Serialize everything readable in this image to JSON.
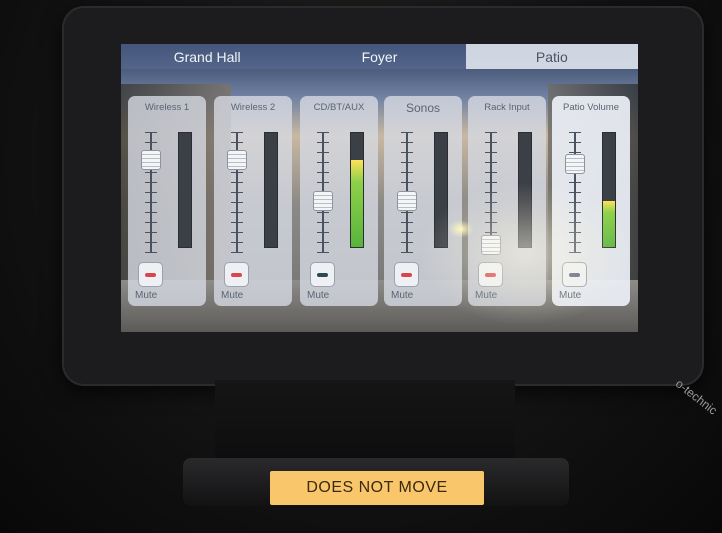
{
  "tabs": [
    {
      "label": "Grand Hall",
      "active": false
    },
    {
      "label": "Foyer",
      "active": false
    },
    {
      "label": "Patio",
      "active": true
    }
  ],
  "channels": [
    {
      "name": "Wireless 1",
      "fader_level": 0.82,
      "meter_level": 0.0,
      "mute_led": "#d9464e",
      "mute_label": "Mute"
    },
    {
      "name": "Wireless 2",
      "fader_level": 0.82,
      "meter_level": 0.0,
      "mute_led": "#d9464e",
      "mute_label": "Mute"
    },
    {
      "name": "CD/BT/AUX",
      "fader_level": 0.45,
      "meter_level": 0.76,
      "mute_led": "#2d4a52",
      "mute_label": "Mute"
    },
    {
      "name": "Sonos",
      "fader_level": 0.45,
      "meter_level": 0.0,
      "mute_led": "#d9464e",
      "mute_label": "Mute"
    },
    {
      "name": "Rack Input",
      "fader_level": 0.05,
      "meter_level": 0.0,
      "mute_led": "#d9464e",
      "mute_label": "Mute"
    },
    {
      "name": "Patio Volume",
      "fader_level": 0.78,
      "meter_level": 0.4,
      "mute_led": "#5a6680",
      "mute_label": "Mute",
      "active": true
    }
  ],
  "base_label": "DOES NOT MOVE",
  "side_text": "o-technic"
}
